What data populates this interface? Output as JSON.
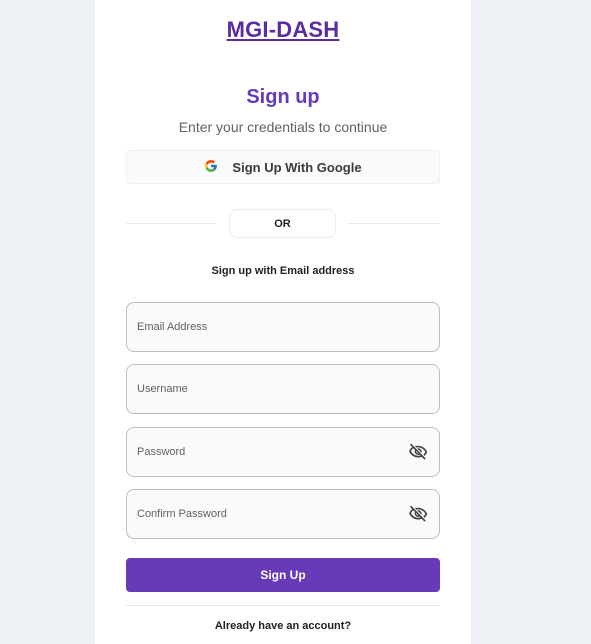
{
  "brand": {
    "name": "MGI-DASH"
  },
  "header": {
    "title": "Sign up",
    "subtitle": "Enter your credentials to continue"
  },
  "google": {
    "label": "Sign Up With Google",
    "icon": "google-icon"
  },
  "divider": {
    "label": "OR"
  },
  "email_section": {
    "heading": "Sign up with Email address"
  },
  "fields": {
    "email": {
      "placeholder": "Email Address",
      "value": ""
    },
    "username": {
      "placeholder": "Username",
      "value": ""
    },
    "password": {
      "placeholder": "Password",
      "value": "",
      "toggle_icon": "eye-off-icon"
    },
    "confirm_password": {
      "placeholder": "Confirm Password",
      "value": "",
      "toggle_icon": "eye-off-icon"
    }
  },
  "submit": {
    "label": "Sign Up"
  },
  "footer": {
    "link": "Already have an account?"
  },
  "colors": {
    "accent": "#673ab7",
    "brand": "#5b2ca0",
    "page_bg": "#eef2f6",
    "field_bg": "#f8fafc",
    "field_border": "#bdbdbd"
  }
}
